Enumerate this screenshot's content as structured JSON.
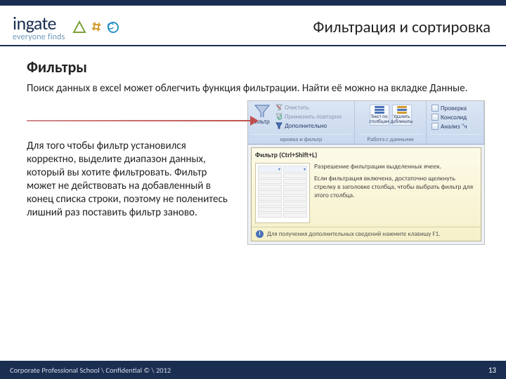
{
  "logo": {
    "name": "ingate",
    "tagline": "everyone finds"
  },
  "page_title": "Фильтрация и сортировка",
  "section_title": "Фильтры",
  "intro": "Поиск данных в excel может облегчить функция фильтрации. Найти её можно на вкладке Данные.",
  "paragraph": "Для того чтобы фильтр установился корректно, выделите диапазон данных, который вы хотите фильтровать. Фильтр может не действовать на добавленный в конец списка строки, поэтому не поленитесь лишний раз поставить фильтр заново.",
  "ribbon": {
    "filter": {
      "button": "ильтр",
      "opt_clear": "Очистить",
      "opt_reapply": "Применить повторно",
      "opt_advanced": "Дополнительно",
      "caption": "ировка и фильтр"
    },
    "data": {
      "btn1a": "Текст по",
      "btn1b": "столбцам",
      "btn2a": "Удалить",
      "btn2b": "дубликаты",
      "caption": "Работа с данными"
    },
    "extra": {
      "r1": "Проверка",
      "r2": "Консолид",
      "r3": "Анализ \"ч"
    }
  },
  "tooltip": {
    "title": "Фильтр (Ctrl+Shift+L)",
    "subtitle": "Разрешение фильтрации выделенных ячеек.",
    "body": "Если фильтрация включена, достаточно щелкнуть стрелку в заголовке столбца, чтобы выбрать фильтр для этого столбца.",
    "footer": "Для получения дополнительных сведений нажмите клавишу F1."
  },
  "footer": {
    "text": "Corporate Professional School \\ Confidential © \\ 2012",
    "page": "13"
  }
}
